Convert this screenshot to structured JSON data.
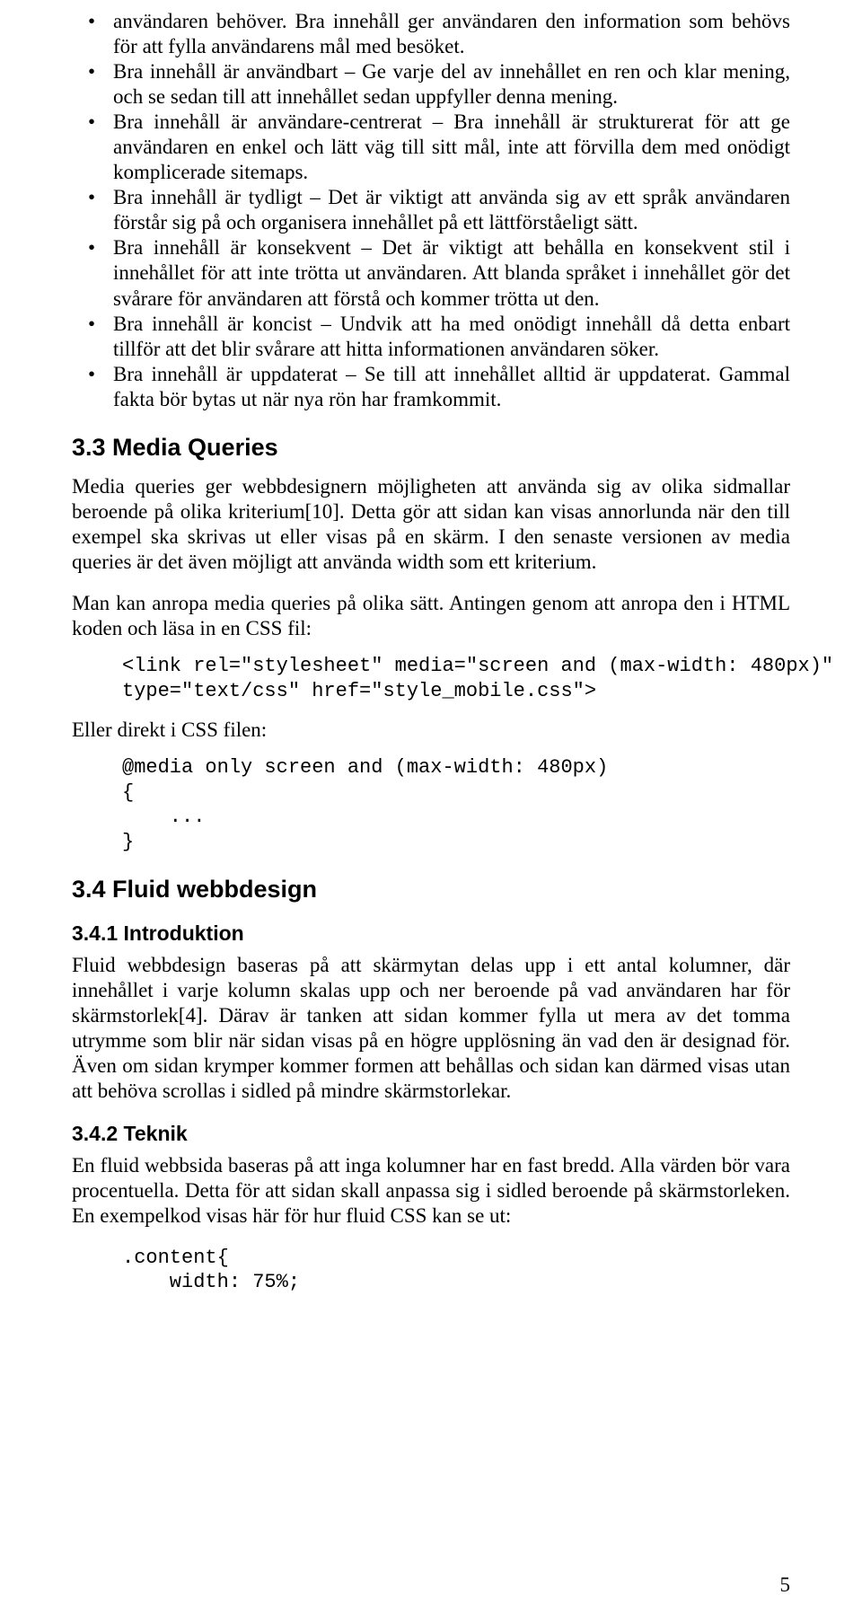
{
  "bullets": [
    "användaren behöver. Bra innehåll ger användaren den information som behövs för att fylla användarens mål med besöket.",
    "Bra innehåll är användbart – Ge varje del av innehållet en ren och klar mening, och se sedan till att innehållet sedan uppfyller denna mening.",
    "Bra innehåll är användare-centrerat – Bra innehåll är strukturerat för att ge användaren en enkel och lätt väg till sitt mål, inte att förvilla dem med onödigt komplicerade sitemaps.",
    "Bra innehåll är tydligt – Det är viktigt att använda sig av ett språk användaren förstår sig på och organisera innehållet på ett lättförståeligt sätt.",
    "Bra innehåll är konsekvent – Det är viktigt att behålla en konsekvent stil i innehållet för att inte trötta ut användaren. Att blanda språket i innehållet gör det svårare för användaren att förstå och kommer trötta ut den.",
    "Bra innehåll är koncist – Undvik att ha med onödigt innehåll då detta enbart tillför att det blir svårare att hitta informationen användaren söker.",
    "Bra innehåll är uppdaterat – Se till att innehållet alltid är uppdaterat. Gammal fakta bör bytas ut när nya rön har framkommit."
  ],
  "h33": "3.3   Media Queries",
  "p33a": "Media queries ger webbdesignern möjligheten att använda sig av olika sidmallar beroende på olika kriterium[10]. Detta gör att sidan kan visas annorlunda när den till exempel ska skrivas ut eller visas på en skärm. I den senaste versionen av media queries är det även möjligt att använda width som ett kriterium.",
  "p33b": "Man kan anropa media queries på olika sätt. Antingen genom att anropa den i HTML koden och läsa in en CSS fil:",
  "code1": "<link rel=\"stylesheet\" media=\"screen and (max-width: 480px)\"\ntype=\"text/css\" href=\"style_mobile.css\">",
  "p33c": "Eller direkt i CSS filen:",
  "code2": "@media only screen and (max-width: 480px)\n{\n    ...\n}",
  "h34": "3.4   Fluid webbdesign",
  "h341": "3.4.1 Introduktion",
  "p341": "Fluid webbdesign baseras på att skärmytan delas upp i ett antal kolumner, där innehållet i varje kolumn skalas upp och ner beroende på vad användaren har för skärmstorlek[4]. Därav är tanken att sidan kommer fylla ut mera av det tomma utrymme som blir när sidan visas på en högre upplösning än vad den är designad för. Även om sidan krymper kommer formen att behållas och sidan kan därmed visas utan att behöva scrollas i sidled på mindre skärmstorlekar.",
  "h342": "3.4.2 Teknik",
  "p342": "En fluid webbsida baseras på att inga kolumner har en fast bredd. Alla värden bör vara procentuella. Detta för att sidan skall anpassa sig i sidled beroende på skärmstorleken. En exempelkod visas här för hur fluid CSS kan se ut:",
  "code3": ".content{\n    width: 75%;",
  "pagenum": "5"
}
